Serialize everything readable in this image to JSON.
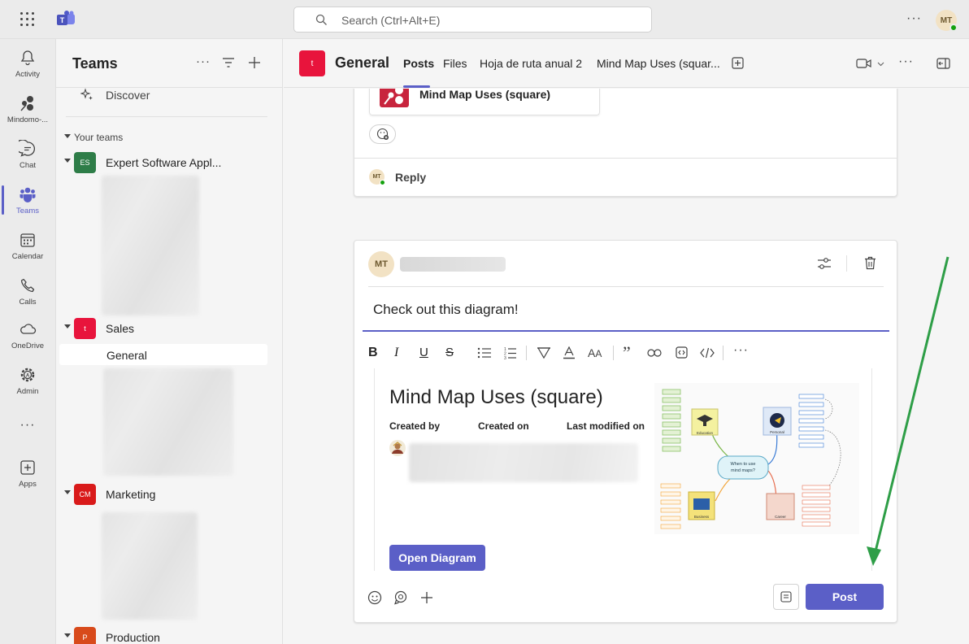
{
  "app": {
    "search_placeholder": "Search (Ctrl+Alt+E)",
    "user_initials": "MT",
    "more": "···"
  },
  "rail": {
    "items": [
      {
        "label": "Activity"
      },
      {
        "label": "Mindomo-..."
      },
      {
        "label": "Chat"
      },
      {
        "label": "Teams"
      },
      {
        "label": "Calendar"
      },
      {
        "label": "Calls"
      },
      {
        "label": "OneDrive"
      },
      {
        "label": "Admin"
      },
      {
        "label": "···"
      },
      {
        "label": "Apps"
      }
    ]
  },
  "leftpane": {
    "title": "Teams",
    "discover": "Discover",
    "your_teams": "Your teams",
    "teams": [
      {
        "name": "Expert Software Appl...",
        "initials": "ES",
        "color": "#2e7d48"
      },
      {
        "name": "Sales",
        "initials": "t",
        "color": "#e8143c"
      },
      {
        "name": "Marketing",
        "initials": "CM",
        "color": "#d91a1a"
      },
      {
        "name": "Production",
        "initials": "P",
        "color": "#d84a1b"
      }
    ],
    "channel": "General"
  },
  "header": {
    "channel_initial": "t",
    "channel_name": "General",
    "tabs": [
      "Posts",
      "Files",
      "Hoja de ruta anual 2",
      "Mind Map Uses (squar..."
    ]
  },
  "previous_post": {
    "card_title": "Mind Map Uses (square)",
    "reply_initials": "MT",
    "reply_label": "Reply"
  },
  "composer": {
    "author_initials": "MT",
    "message": "Check out this diagram!",
    "card": {
      "title": "Mind Map Uses (square)",
      "created_by": "Created by",
      "created_on": "Created on",
      "last_modified_on": "Last modified on",
      "open_button": "Open Diagram"
    },
    "mindmap": {
      "center": "When to use mind maps?",
      "nodes": [
        "Education",
        "Personal",
        "Business",
        "Career"
      ]
    },
    "post_button": "Post"
  },
  "colors": {
    "accent": "#5b5fc7",
    "sales": "#e8143c",
    "arrow": "#2e9e47"
  }
}
